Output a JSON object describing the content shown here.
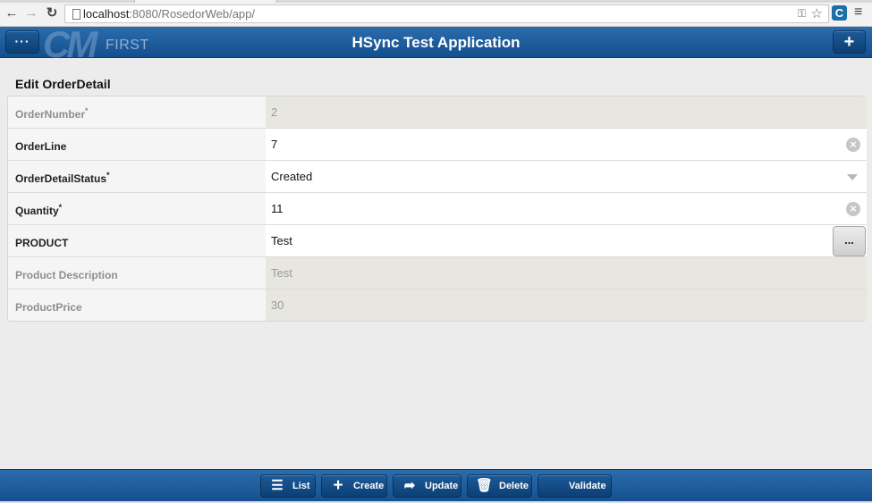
{
  "browser": {
    "url_host": "localhost",
    "url_rest": ":8080/RosedorWeb/app/",
    "icons": [
      "back-arrow-icon",
      "forward-arrow-icon",
      "reload-icon",
      "page-icon",
      "key-icon",
      "star-icon",
      "extension-icon",
      "menu-icon"
    ]
  },
  "header": {
    "menu_label": "···",
    "plus_label": "+",
    "logo_mark": "CM",
    "logo_text": "FIRST",
    "title": "HSync Test Application",
    "bar_color": "#1f5c9c"
  },
  "form": {
    "title": "Edit OrderDetail",
    "rows": [
      {
        "label": "OrderNumber",
        "required": "*",
        "value": "2",
        "disabled": true
      },
      {
        "label": "OrderLine",
        "required": "",
        "value": "7",
        "disabled": false,
        "control": "clear"
      },
      {
        "label": "OrderDetailStatus",
        "required": "*",
        "value": "Created",
        "disabled": false,
        "control": "dropdown"
      },
      {
        "label": "Quantity",
        "required": "*",
        "value": "11",
        "disabled": false,
        "control": "clear"
      },
      {
        "label": "PRODUCT",
        "required": "",
        "value": "Test",
        "disabled": false,
        "control": "lookup",
        "lookup_label": "..."
      },
      {
        "label": "Product Description",
        "required": "",
        "value": "Test",
        "disabled": true
      },
      {
        "label": "ProductPrice",
        "required": "",
        "value": "30",
        "disabled": true
      }
    ]
  },
  "footer": {
    "buttons": [
      {
        "label": "List",
        "icon": "list-icon"
      },
      {
        "label": "Create",
        "icon": "plus-icon"
      },
      {
        "label": "Update",
        "icon": "share-icon"
      },
      {
        "label": "Delete",
        "icon": "trash-icon"
      },
      {
        "label": "Validate",
        "icon": ""
      }
    ]
  }
}
